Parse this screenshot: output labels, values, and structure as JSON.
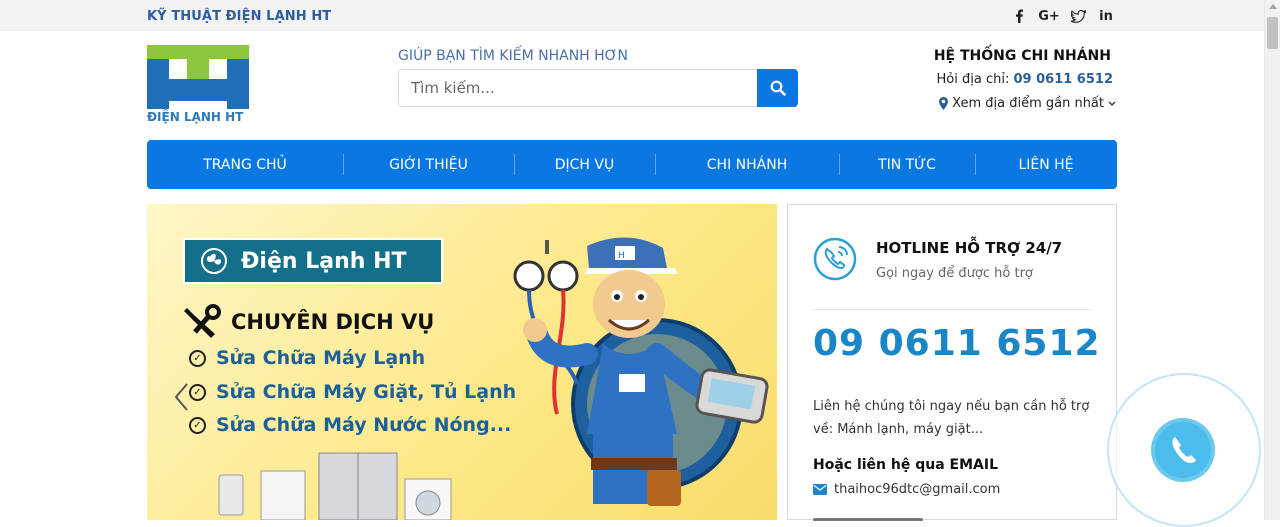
{
  "topbar": {
    "site_name": "KỸ THUẬT ĐIỆN LẠNH HT",
    "social": [
      {
        "icon": "facebook-icon",
        "glyph": "f"
      },
      {
        "icon": "google-plus-icon",
        "glyph": "G+"
      },
      {
        "icon": "twitter-icon",
        "glyph": "t"
      },
      {
        "icon": "linkedin-icon",
        "glyph": "in"
      }
    ]
  },
  "logo": {
    "text": "ĐIỆN LẠNH HT",
    "colors": {
      "green": "#8cc63f",
      "blue": "#1e6fb5"
    }
  },
  "search": {
    "hint": "GIÚP BẠN TÌM KIẾM NHANH HƠN",
    "placeholder": "Tìm kiếm...",
    "button_icon": "search-icon"
  },
  "branch": {
    "title": "HỆ THỐNG CHI NHÁNH",
    "phone_label": "Hỏi địa chỉ:",
    "phone": "09 0611 6512",
    "location_link": "Xem địa điểm gần nhất"
  },
  "nav": {
    "items": [
      "TRANG CHỦ",
      "GIỚI THIỆU",
      "DỊCH VỤ",
      "CHI NHÁNH",
      "TIN TỨC",
      "LIÊN HỆ"
    ],
    "color": "#0a78e0"
  },
  "banner": {
    "brand": "Điện Lạnh HT",
    "heading": "CHUYÊN DỊCH VỤ",
    "services": [
      "Sửa Chữa Máy Lạnh",
      "Sửa Chữa Máy Giặt, Tủ Lạnh",
      "Sửa Chữa Máy Nước Nóng..."
    ]
  },
  "hotline": {
    "title": "HOTLINE HỖ TRỢ 24/7",
    "subtitle": "Gọi ngay để được hỗ trợ",
    "phone": "09 0611 6512",
    "description": "Liên hệ chúng tôi ngay nếu bạn cần hỗ trợ về: Mánh lạnh, máy giặt...",
    "email_heading": "Hoặc liên hệ qua EMAIL",
    "email": "thaihoc96dtc@gmail.com"
  }
}
